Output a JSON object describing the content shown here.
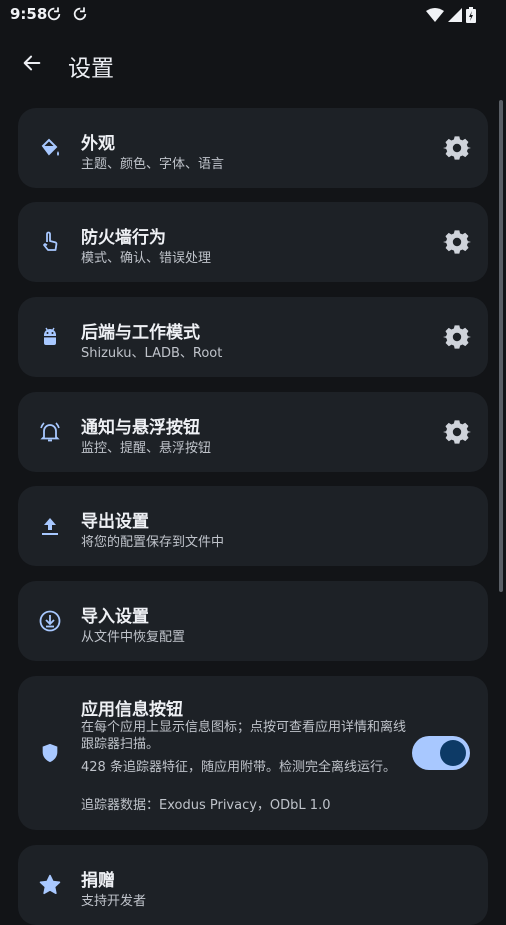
{
  "status_bar": {
    "time": "9:58"
  },
  "app_bar": {
    "title": "设置"
  },
  "colors": {
    "accent": "#a8c8ff",
    "card": "#1d2126",
    "background": "#121417"
  },
  "items": [
    {
      "title": "外观",
      "subtitle": "主题、颜色、字体、语言",
      "icon": "paint-bucket-icon",
      "action": "gear-icon"
    },
    {
      "title": "防火墙行为",
      "subtitle": "模式、确认、错误处理",
      "icon": "touch-hand-icon",
      "action": "gear-icon"
    },
    {
      "title": "后端与工作模式",
      "subtitle": "Shizuku、LADB、Root",
      "icon": "android-icon",
      "action": "gear-icon"
    },
    {
      "title": "通知与悬浮按钮",
      "subtitle": "监控、提醒、悬浮按钮",
      "icon": "bell-ring-icon",
      "action": "gear-icon"
    },
    {
      "title": "导出设置",
      "subtitle": "将您的配置保存到文件中",
      "icon": "upload-icon"
    },
    {
      "title": "导入设置",
      "subtitle": "从文件中恢复配置",
      "icon": "download-circle-icon"
    }
  ],
  "app_info": {
    "title": "应用信息按钮",
    "description": "在每个应用上显示信息图标；点按可查看应用详情和离线跟踪器扫描。",
    "detail": "428 条追踪器特征，随应用附带。检测完全离线运行。",
    "source": "追踪器数据：Exodus Privacy，ODbL 1.0",
    "enabled": true,
    "icon": "shield-icon"
  },
  "donate": {
    "title": "捐赠",
    "subtitle": "支持开发者",
    "icon": "star-icon"
  }
}
